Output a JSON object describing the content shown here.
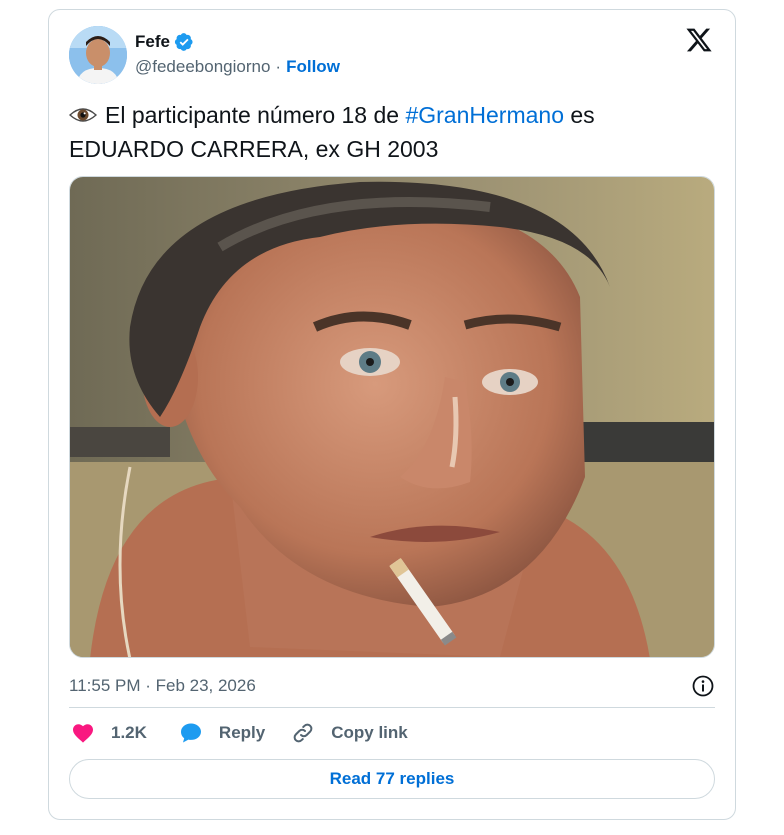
{
  "tweet": {
    "author": {
      "name": "Fefe",
      "handle": "@fedeebongiorno",
      "separator": "·",
      "follow_label": "Follow"
    },
    "text": {
      "emoji": "👁",
      "before": "El participante número 18 de ",
      "hashtag": "#GranHermano",
      "after": " es EDUARDO CARRERA, ex GH 2003"
    },
    "timestamp": "11:55 PM · Feb 23, 2026",
    "actions": {
      "like_count": "1.2K",
      "reply_label": "Reply",
      "copy_label": "Copy link"
    },
    "read_replies_label": "Read 77 replies"
  },
  "colors": {
    "accent": "#006fd6",
    "like": "#f91880",
    "reply_icon": "#1d9bf0",
    "secondary_text": "#536471",
    "border": "#cfd9de"
  },
  "icons": {
    "verified": "verified-badge-icon",
    "brand": "x-logo-icon",
    "info": "info-icon",
    "like": "heart-icon",
    "reply": "speech-bubble-icon",
    "copy": "link-icon"
  }
}
